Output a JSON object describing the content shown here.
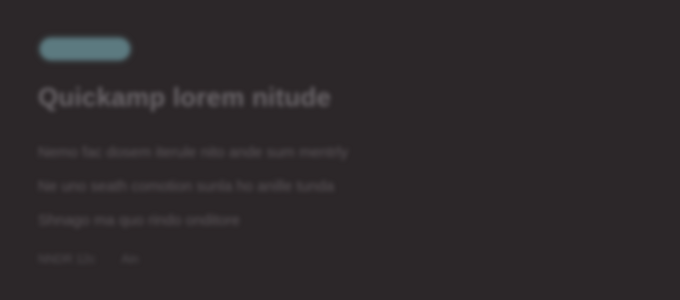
{
  "card": {
    "badge_label": "",
    "headline": "Quickamp lorem nitude",
    "body_lines": [
      "Nemo fac dosem iterule nito ande sum mentrly",
      "Ne uno seath comotion sunla ho anille tunda",
      "Shnago ma quo rindo onditore"
    ],
    "meta_left": "NNDR 12c",
    "meta_right": "Ain"
  }
}
